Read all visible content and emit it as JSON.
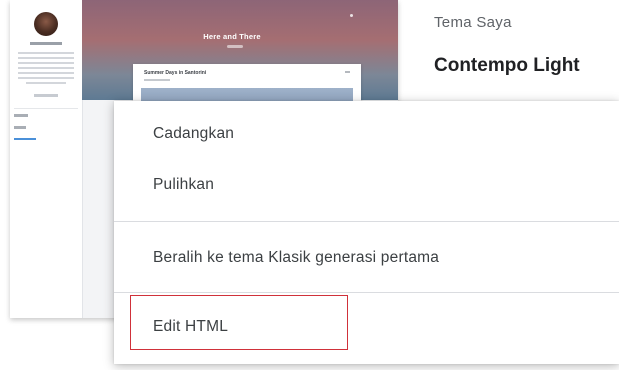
{
  "preview": {
    "blog_title": "Here and There",
    "post_title": "Summer Days in Santorini",
    "colors": {
      "hero_top": "#8d6577",
      "hero_bottom": "#5e7a93",
      "post_image": "#7d93b2",
      "link": "#4a90d9"
    }
  },
  "header": {
    "label": "Tema Saya",
    "theme_name": "Contempo Light"
  },
  "menu": {
    "items": [
      {
        "label": "Cadangkan"
      },
      {
        "label": "Pulihkan"
      },
      {
        "label": "Beralih ke tema Klasik generasi pertama"
      },
      {
        "label": "Edit HTML"
      }
    ],
    "highlighted_item": "Edit HTML",
    "highlight_color": "#d0313a"
  }
}
